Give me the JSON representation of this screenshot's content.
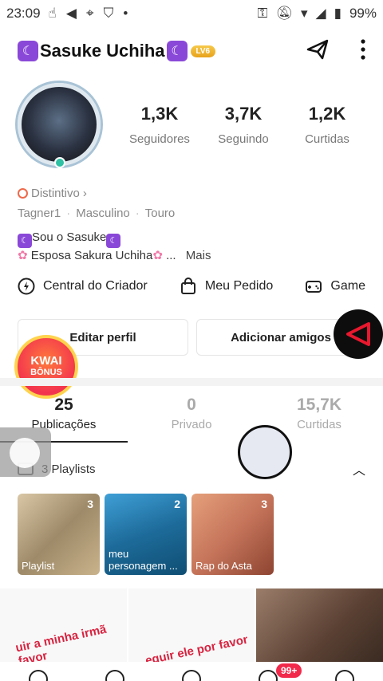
{
  "status_bar": {
    "time": "23:09",
    "battery": "99%"
  },
  "profile": {
    "name": "Sasuke Uchiha",
    "level_badge": "LV6",
    "badge_label": "Distintivo",
    "tags": [
      "Tagner1",
      "Masculino",
      "Touro"
    ],
    "bio_line1": "Sou o Sasuke",
    "bio_line2": "Esposa Sakura Uchiha",
    "bio_more_ellipsis": "...",
    "bio_more": "Mais"
  },
  "stats": [
    {
      "value": "1,3K",
      "label": "Seguidores"
    },
    {
      "value": "3,7K",
      "label": "Seguindo"
    },
    {
      "value": "1,2K",
      "label": "Curtidas"
    }
  ],
  "tools": {
    "creator": "Central do Criador",
    "order": "Meu Pedido",
    "game": "Game"
  },
  "buttons": {
    "edit": "Editar perfil",
    "add": "Adicionar amigos"
  },
  "kwai_bonus": {
    "line1": "KWAI",
    "line2": "BÔNUS"
  },
  "post_tabs": [
    {
      "value": "25",
      "label": "Publicações"
    },
    {
      "value": "0",
      "label": "Privado"
    },
    {
      "value": "15,7K",
      "label": "Curtidas"
    }
  ],
  "playlists": {
    "header": "3 Playlists",
    "items": [
      {
        "name": "Playlist",
        "count": "3"
      },
      {
        "name": "meu personagem ...",
        "count": "2"
      },
      {
        "name": "Rap do Asta",
        "count": "3"
      }
    ]
  },
  "grid_captions": [
    "uir a minha irmã favor",
    "eguir ele por favor",
    ""
  ],
  "notifications_badge": "99+",
  "colors": {
    "accent": "#f2294a",
    "moon_purple": "#8a48d8",
    "level_gold": "#e8a21a"
  }
}
